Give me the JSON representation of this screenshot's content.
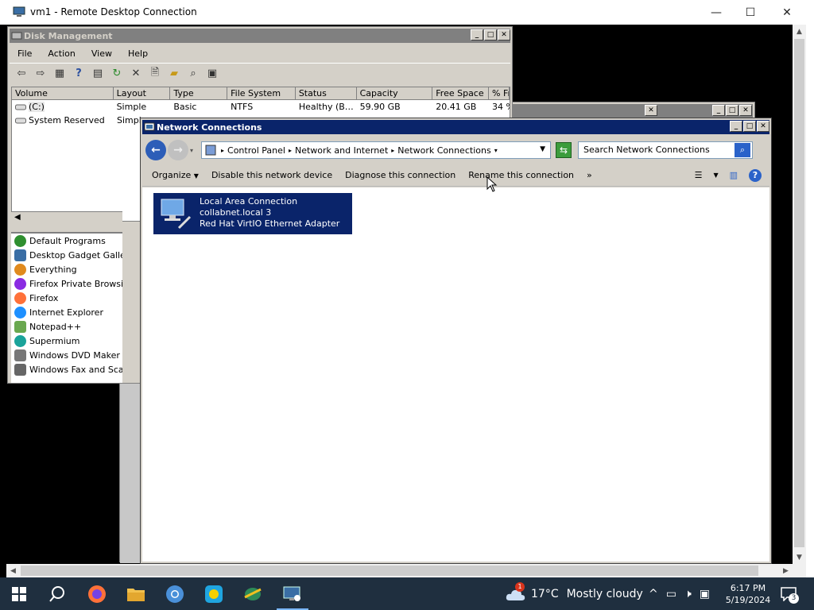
{
  "host": {
    "title": "vm1 - Remote Desktop Connection",
    "minimize": "—",
    "maximize": "☐",
    "close": "✕"
  },
  "disk_management": {
    "title": "Disk Management",
    "menu": [
      "File",
      "Action",
      "View",
      "Help"
    ],
    "columns": [
      "Volume",
      "Layout",
      "Type",
      "File System",
      "Status",
      "Capacity",
      "Free Space",
      "% Fr"
    ],
    "rows": [
      {
        "volume": "(C:)",
        "layout": "Simple",
        "type": "Basic",
        "fs": "NTFS",
        "status": "Healthy (B…",
        "capacity": "59.90 GB",
        "free": "20.41 GB",
        "pct": "34 %"
      },
      {
        "volume": "System Reserved",
        "layout": "Simpl",
        "type": "",
        "fs": "",
        "status": "",
        "capacity": "",
        "free": "",
        "pct": ""
      }
    ]
  },
  "programs": [
    {
      "label": "Default Programs",
      "color": "#2f8f2f"
    },
    {
      "label": "Desktop Gadget Gallery",
      "color": "#3a6ea5"
    },
    {
      "label": "Everything",
      "color": "#e08a1e"
    },
    {
      "label": "Firefox Private Browsing",
      "color": "#8a2be2"
    },
    {
      "label": "Firefox",
      "color": "#ff7139"
    },
    {
      "label": "Internet Explorer",
      "color": "#1e90ff"
    },
    {
      "label": "Notepad++",
      "color": "#6aa84f"
    },
    {
      "label": "Supermium",
      "color": "#1aa39a"
    },
    {
      "label": "Windows DVD Maker",
      "color": "#777777"
    },
    {
      "label": "Windows Fax and Scan",
      "color": "#666666"
    }
  ],
  "network_connections": {
    "title": "Network Connections",
    "breadcrumb": [
      "Control Panel",
      "Network and Internet",
      "Network Connections"
    ],
    "search_placeholder": "Search Network Connections",
    "commands": [
      "Organize",
      "Disable this network device",
      "Diagnose this connection",
      "Rename this connection",
      "»"
    ],
    "adapter": {
      "name": "Local Area Connection",
      "network": "collabnet.local  3",
      "device": "Red Hat VirtIO Ethernet Adapter"
    }
  },
  "taskbar": {
    "weather_temp": "17°C",
    "weather_text": "Mostly cloudy",
    "weather_badge": "1",
    "time": "6:17 PM",
    "date": "5/19/2024",
    "notification_count": "3"
  }
}
